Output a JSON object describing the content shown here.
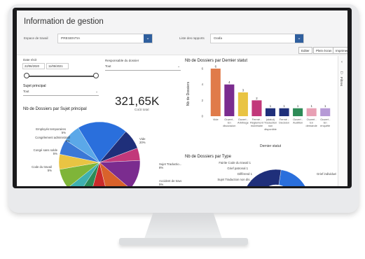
{
  "report": {
    "title": "Information de gestion",
    "filter1_label": "Espace de travail",
    "filter1_value": "PRESENTIA",
    "filter2_label": "Liste des rapports",
    "filter2_value": "Grafa",
    "buttons": [
      "Editer",
      "Plein écran",
      "Imprimer"
    ]
  },
  "left": {
    "date_label": "Date récit",
    "date_from": "22/06/2020",
    "date_to": "11/05/2021",
    "resp_label": "Responsable du dossier",
    "resp_value": "Tout",
    "sujet_label": "Sujet principal",
    "sujet_value": "Tout",
    "kpi_value": "321,65K",
    "kpi_label": "Coût total"
  },
  "side_panel": {
    "label": "Filtres"
  },
  "chart_data": [
    {
      "type": "pie",
      "title": "Nb de Dossiers par Sujet principal",
      "slices": [
        {
          "label": "Vide",
          "value": 20,
          "color": "#2a6fdc"
        },
        {
          "label": "Sujet Traductio...",
          "value": 8,
          "color": "#1f2f7a"
        },
        {
          "label": "Accident de travail",
          "value": 5,
          "color": "#c2387a"
        },
        {
          "label": "",
          "value": 12,
          "color": "#7b2c8f"
        },
        {
          "label": "",
          "value": 10,
          "color": "#d9622b"
        },
        {
          "label": "",
          "value": 8,
          "color": "#c92b2b"
        },
        {
          "label": "Code du travail",
          "value": 5,
          "color": "#2e8b57"
        },
        {
          "label": "Congé sans solde",
          "value": 5,
          "color": "#3fb0b0"
        },
        {
          "label": "Congélement administratif",
          "value": 8,
          "color": "#7fb539"
        },
        {
          "label": "Employés temporaires",
          "value": 6,
          "color": "#e9c443"
        },
        {
          "label": "",
          "value": 6,
          "color": "#3b78d6"
        },
        {
          "label": "",
          "value": 7,
          "color": "#5ba8e8"
        }
      ],
      "labels": [
        "Employés temporaires 5%",
        "Congélement administratif 8%",
        "Congé sans solde 5%",
        "Code du travail 5%",
        "Vide 20%",
        "Sujet Traductio... 8%",
        "Accident de travail 5%"
      ]
    },
    {
      "type": "bar",
      "title": "Nb de Dossiers par Dernier statut",
      "xlabel": "Dernier statut",
      "ylabel": "Nb de Dossiers",
      "ylim": [
        0,
        6
      ],
      "categories": [
        "Vide",
        "Ouvert - En discussion",
        "Ouvert - Arbitrage",
        "Fermé - Règlement monétaire",
        "(statut) Traduction non disponible",
        "Fermé - Décision",
        "Ouvert - Audition",
        "Ouvert - En demande",
        "Ouvert - En enquête"
      ],
      "tick_labels": [
        "Vide",
        "Ouvert - En discussion",
        "Ouvert - Arbitrage",
        "Fermé - Règlement monétaire",
        "(statut) Traduction non disponible",
        "Fermé - Décision",
        "Ouvert - Audition",
        "Ouvert - En demande",
        "Ouvert - En enquête"
      ],
      "values": [
        6,
        4,
        3,
        2,
        1,
        1,
        1,
        1,
        1
      ],
      "colors": [
        "#e07b4a",
        "#7b2c8f",
        "#e9c443",
        "#c2387a",
        "#1f2f7a",
        "#1f2f7a",
        "#2e8b57",
        "#e8a0b4",
        "#b69ad6"
      ]
    },
    {
      "type": "pie",
      "title": "Nb de Dossiers par Type",
      "donut": true,
      "slices": [
        {
          "label": "Grief individuel",
          "value": 45,
          "color": "#2a6fdc"
        },
        {
          "label": "Fairite Code du travail",
          "value": 8,
          "color": "#2e8b57"
        },
        {
          "label": "Grief patronal",
          "value": 8,
          "color": "#e9c443"
        },
        {
          "label": "Différend",
          "value": 10,
          "color": "#7b2c8f"
        },
        {
          "label": "Sujet Traduction non dis...",
          "value": 8,
          "color": "#c2387a"
        },
        {
          "label": "",
          "value": 21,
          "color": "#1f2f7a"
        }
      ],
      "labels": [
        "Fairite Code du travail 1",
        "Grief patronal 1",
        "Différend 1",
        "Sujet Traduction non dis..."
      ]
    }
  ]
}
